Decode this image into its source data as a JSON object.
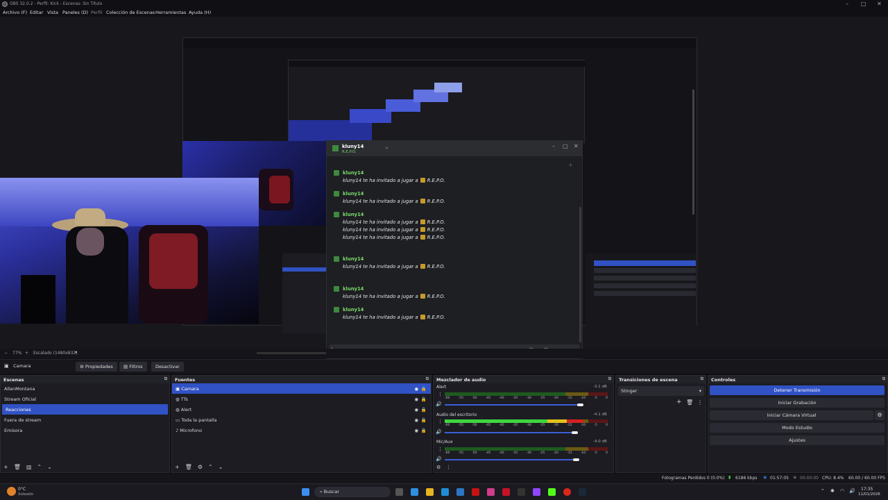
{
  "app": {
    "title": "OBS 32.0.2 - Perfil: Kick - Escenas: Sin Título"
  },
  "menu": [
    "Archivo (F)",
    "Editar",
    "Vista",
    "Paneles (D)",
    "Perfil",
    "Colección de Escenas",
    "Herramientas",
    "Ayuda (H)"
  ],
  "zoom": {
    "percent": "77%",
    "scale_label": "Escalado (1480x832)"
  },
  "source_bar": {
    "source_name": "Camara",
    "properties_label": "Propiedades",
    "filters_label": "Filtros",
    "deactivate_label": "Desactivar"
  },
  "scenes": {
    "header": "Escenas",
    "items": [
      "AllanMontana",
      "Stream Oficial",
      "Reacciones",
      "Fuera de stream",
      "Emisora"
    ],
    "selected": "Reacciones"
  },
  "sources": {
    "header": "Fuentes",
    "items": [
      "Camara",
      "TTs",
      "Alert",
      "Toda la pantalla",
      "Microfono"
    ],
    "selected": "Camara"
  },
  "mixer": {
    "header": "Mezclador de audio",
    "channels": [
      {
        "name": "Alert",
        "db": "-3.1 dB",
        "level": 0,
        "volume": 0.85
      },
      {
        "name": "Audio del escritorio",
        "db": "-4.1 dB",
        "level": 0.5,
        "volume": 0.8
      },
      {
        "name": "Mic/Aux",
        "db": "-4.0 dB",
        "level": 0,
        "volume": 0.81
      }
    ],
    "ticks": [
      "-60",
      "-55",
      "-50",
      "-45",
      "-40",
      "-35",
      "-30",
      "-25",
      "-20",
      "-15",
      "-10",
      "-5",
      "0"
    ]
  },
  "transitions": {
    "header": "Transiciones de escena",
    "selected": "Stinger"
  },
  "controls": {
    "header": "Controles",
    "stop_stream": "Detener Transmisión",
    "start_recording": "Iniciar Grabación",
    "start_virtualcam": "Iniciar Cámara Virtual",
    "studio_mode": "Modo Estudio",
    "settings": "Ajustes"
  },
  "status": {
    "dropped_frames": "Fotogramas Perdidos 0 (0.0%)",
    "bitrate": "6186 kbps",
    "stream_time": "01:57:05",
    "rec_time": "00:00:00",
    "cpu": "CPU: 8.4%",
    "fps": "60.00 / 60.00 FPS"
  },
  "chat": {
    "user": "kluny14",
    "subtitle": "R.E.P.O.",
    "invite_prefix": "kluny14 te ha invitado a jugar a",
    "game": "R.E.P.O.",
    "messages": [
      {
        "lines": 1
      },
      {
        "lines": 1
      },
      {
        "lines": 3
      },
      {
        "lines": 1
      },
      {
        "lines": 1
      },
      {
        "lines": 1
      }
    ]
  },
  "taskbar": {
    "weather_temp": "0°C",
    "weather_desc": "Soleado",
    "search_placeholder": "Buscar",
    "time": "17:35",
    "date": "11/01/2026"
  },
  "colors": {
    "accent": "#3152c4",
    "background": "#1c1c22"
  }
}
